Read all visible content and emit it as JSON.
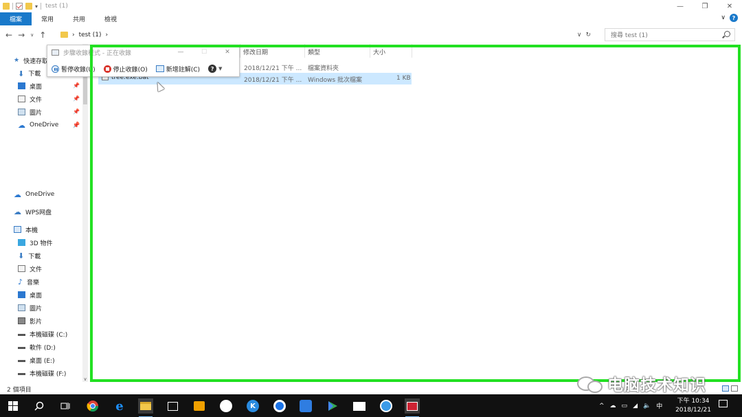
{
  "window": {
    "title": "test (1)",
    "minimize": "—",
    "restore": "❐",
    "close": "✕"
  },
  "ribbon": {
    "tabs": [
      "檔案",
      "常用",
      "共用",
      "檢視"
    ],
    "collapse": "∨",
    "help": "?"
  },
  "address": {
    "path_sep": "›",
    "folder": "test (1)",
    "path_end": "›",
    "dropdown": "∨",
    "refresh": "↻",
    "search_placeholder": "搜尋 test (1)"
  },
  "nav_buttons": {
    "back": "←",
    "forward": "→",
    "recent": "∨",
    "up": "↑"
  },
  "nav_pane": {
    "quick_access": "快速存取",
    "pinned": [
      {
        "label": "下載",
        "icon": "download-icon"
      },
      {
        "label": "桌面",
        "icon": "desktop-icon"
      },
      {
        "label": "文件",
        "icon": "document-icon"
      },
      {
        "label": "圖片",
        "icon": "pictures-icon"
      },
      {
        "label": "OneDrive",
        "icon": "onedrive-icon"
      }
    ],
    "onedrive": "OneDrive",
    "wps": "WPS网盘",
    "this_pc": "本機",
    "pc_items": [
      {
        "label": "3D 物件",
        "icon": "3d-objects-icon"
      },
      {
        "label": "下載",
        "icon": "download-icon"
      },
      {
        "label": "文件",
        "icon": "document-icon"
      },
      {
        "label": "音樂",
        "icon": "music-icon"
      },
      {
        "label": "桌面",
        "icon": "desktop-icon"
      },
      {
        "label": "圖片",
        "icon": "pictures-icon"
      },
      {
        "label": "影片",
        "icon": "videos-icon"
      },
      {
        "label": "本機磁碟 (C:)",
        "icon": "drive-icon"
      },
      {
        "label": "軟件 (D:)",
        "icon": "drive-icon"
      },
      {
        "label": "桌面 (E:)",
        "icon": "drive-icon"
      },
      {
        "label": "本機磁碟 (F:)",
        "icon": "drive-icon"
      }
    ]
  },
  "columns": {
    "modified": "修改日期",
    "type": "類型",
    "size": "大小"
  },
  "files": [
    {
      "name": "",
      "modified": "2018/12/21 下午 ...",
      "type": "檔案資料夾",
      "size": ""
    },
    {
      "name": "tree.exe.bat",
      "modified": "2018/12/21 下午 ...",
      "type": "Windows 批次檔案",
      "size": "1 KB"
    }
  ],
  "steps_recorder": {
    "title": "步驟收錄程式 - 正在收錄",
    "minimize": "—",
    "maximize": "☐",
    "close": "✕",
    "pause": "暫停收錄(U)",
    "stop": "停止收錄(O)",
    "add_comment": "新增註解(C)",
    "help": "?",
    "dropdown": "▼"
  },
  "status": {
    "item_count": "2 個項目"
  },
  "watermark": {
    "text": "电脑技术知识"
  },
  "taskbar": {
    "tray_lang": "中",
    "time": "下午 10:34",
    "date": "2018/12/21"
  },
  "colors": {
    "accent": "#1979ca",
    "highlight_box": "#22e022",
    "selection": "#cce8ff"
  }
}
